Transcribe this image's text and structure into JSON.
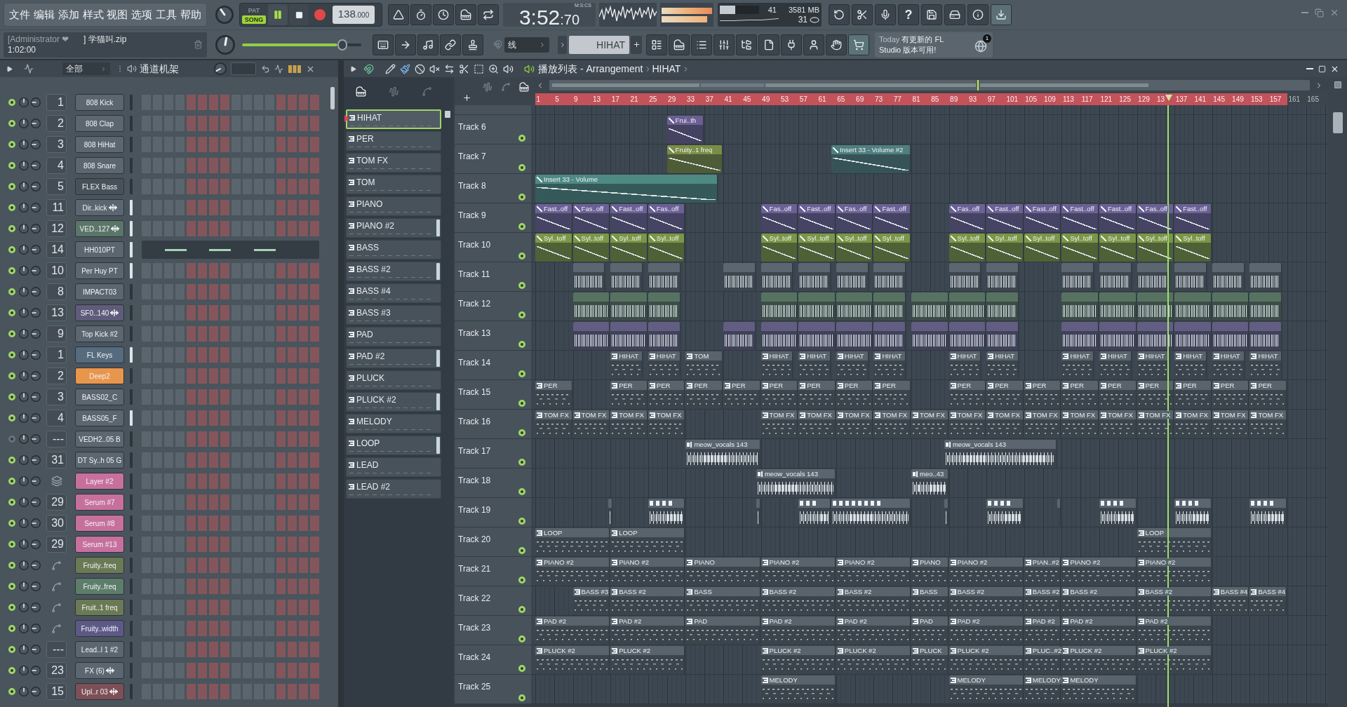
{
  "menu": [
    "文件",
    "编辑",
    "添加",
    "样式",
    "视图",
    "选项",
    "工具",
    "帮助"
  ],
  "transport": {
    "modes": [
      {
        "label": "PAT",
        "selected": false
      },
      {
        "label": "SONG",
        "selected": true
      }
    ],
    "playing": true,
    "tempo": "138",
    "tempo_fraction": ".000"
  },
  "clock": {
    "time": "3:52",
    "fraction": ":70",
    "unit": "M:S:CS"
  },
  "cpu": {
    "value": "41",
    "level": 0.4
  },
  "memory": "3581 MB",
  "polyphony": "31",
  "help_label": "?",
  "project": {
    "user": "[Administrator ❤",
    "file": "] 学猫叫.zip",
    "time": "1:02:00"
  },
  "master_volume": {
    "level": 0.84
  },
  "snap": "线",
  "pattern_selector": "HIHAT",
  "news": {
    "day": "Today",
    "message": "有更新的 FL Studio 版本可用!",
    "badge": "1"
  },
  "channel_rack": {
    "filter": "全部",
    "title": "通道机架",
    "channels": [
      {
        "name": "808 Kick",
        "mixer": "1",
        "kind": "instrument",
        "color": "#5b6670",
        "enabled": true,
        "selected": false
      },
      {
        "name": "808 Clap",
        "mixer": "2",
        "kind": "instrument",
        "color": "#5b6670",
        "enabled": true,
        "selected": false
      },
      {
        "name": "808 HiHat",
        "mixer": "3",
        "kind": "instrument",
        "color": "#5b6670",
        "enabled": true,
        "selected": false
      },
      {
        "name": "808 Snare",
        "mixer": "4",
        "kind": "instrument",
        "color": "#5b6670",
        "enabled": true,
        "selected": false
      },
      {
        "name": "FLEX Bass",
        "mixer": "5",
        "kind": "instrument",
        "color": "#47515a",
        "enabled": true,
        "selected": false
      },
      {
        "name": "Dir..kick",
        "mixer": "11",
        "kind": "sample",
        "color": "#5b6670",
        "enabled": true,
        "selected": true
      },
      {
        "name": "VED..127",
        "mixer": "12",
        "kind": "sample",
        "color": "#5b7668",
        "enabled": true,
        "selected": true
      },
      {
        "name": "HH010PT",
        "mixer": "14",
        "kind": "instrument",
        "color": "#5b6670",
        "enabled": true,
        "selected": true,
        "pianoroll": true
      },
      {
        "name": "Per Huy PT",
        "mixer": "10",
        "kind": "instrument",
        "color": "#5b6670",
        "enabled": true,
        "selected": true
      },
      {
        "name": "IMPACT03",
        "mixer": "8",
        "kind": "instrument",
        "color": "#5b6670",
        "enabled": true,
        "selected": false
      },
      {
        "name": "SF0..140",
        "mixer": "13",
        "kind": "sample",
        "color": "#5f5b7b",
        "enabled": true,
        "selected": false
      },
      {
        "name": "Top Kick #2",
        "mixer": "9",
        "kind": "instrument",
        "color": "#5b6670",
        "enabled": true,
        "selected": false
      },
      {
        "name": "FL Keys",
        "mixer": "1",
        "kind": "instrument",
        "color": "#566b7e",
        "enabled": true,
        "selected": true
      },
      {
        "name": "Deep2",
        "mixer": "2",
        "kind": "instrument",
        "color": "#e8964c",
        "enabled": true,
        "selected": false
      },
      {
        "name": "BASS02_C",
        "mixer": "3",
        "kind": "instrument",
        "color": "#5b6670",
        "enabled": true,
        "selected": false
      },
      {
        "name": "BASS05_F",
        "mixer": "4",
        "kind": "instrument",
        "color": "#5b6670",
        "enabled": true,
        "selected": true
      },
      {
        "name": "VEDH2..05 B",
        "mixer": "---",
        "kind": "instrument",
        "color": "#5b6670",
        "enabled": false,
        "selected": false
      },
      {
        "name": "DT Sy..h 05 G",
        "mixer": "31",
        "kind": "instrument",
        "color": "#5b6670",
        "enabled": true,
        "selected": false
      },
      {
        "name": "Layer #2",
        "kind": "layer",
        "color": "#c7709e",
        "enabled": true,
        "selected": false
      },
      {
        "name": "Serum #7",
        "mixer": "29",
        "kind": "instrument",
        "color": "#c7709e",
        "enabled": true,
        "selected": false
      },
      {
        "name": "Serum #8",
        "mixer": "30",
        "kind": "instrument",
        "color": "#c7709e",
        "enabled": true,
        "selected": false
      },
      {
        "name": "Serum #13",
        "mixer": "29",
        "kind": "instrument",
        "color": "#c7709e",
        "enabled": true,
        "selected": false
      },
      {
        "name": "Fruity..freq",
        "kind": "automation",
        "color": "#6a7a54",
        "enabled": true,
        "selected": false
      },
      {
        "name": "Fruity..freq",
        "kind": "automation",
        "color": "#5d7d6b",
        "enabled": true,
        "selected": false
      },
      {
        "name": "Fruit..1 freq",
        "kind": "automation",
        "color": "#6a7a54",
        "enabled": true,
        "selected": false
      },
      {
        "name": "Fruity..width",
        "kind": "automation",
        "color": "#5d5987",
        "enabled": true,
        "selected": false
      },
      {
        "name": "Lead..l 1 #2",
        "mixer": "---",
        "kind": "instrument",
        "color": "#5b6670",
        "enabled": true,
        "selected": false
      },
      {
        "name": "FX (6)",
        "mixer": "23",
        "kind": "sample",
        "color": "#5b6670",
        "enabled": true,
        "selected": false
      },
      {
        "name": "Upl..r 03",
        "mixer": "15",
        "kind": "sample",
        "color": "#7d4f57",
        "enabled": true,
        "selected": false
      }
    ]
  },
  "playlist": {
    "title": "播放列表 - Arrangement",
    "crumb": "HIHAT",
    "patterns": [
      {
        "name": "HIHAT",
        "selected": true,
        "marked": false
      },
      {
        "name": "PER",
        "selected": false,
        "marked": false
      },
      {
        "name": "TOM FX",
        "selected": false,
        "marked": false
      },
      {
        "name": "TOM",
        "selected": false,
        "marked": false
      },
      {
        "name": "PIANO",
        "selected": false,
        "marked": false
      },
      {
        "name": "PIANO #2",
        "selected": false,
        "marked": true
      },
      {
        "name": "BASS",
        "selected": false,
        "marked": false
      },
      {
        "name": "BASS #2",
        "selected": false,
        "marked": true
      },
      {
        "name": "BASS #4",
        "selected": false,
        "marked": false
      },
      {
        "name": "BASS #3",
        "selected": false,
        "marked": false
      },
      {
        "name": "PAD",
        "selected": false,
        "marked": false
      },
      {
        "name": "PAD #2",
        "selected": false,
        "marked": true
      },
      {
        "name": "PLUCK",
        "selected": false,
        "marked": false
      },
      {
        "name": "PLUCK #2",
        "selected": false,
        "marked": true
      },
      {
        "name": "MELODY",
        "selected": false,
        "marked": false
      },
      {
        "name": "LOOP",
        "selected": false,
        "marked": true
      },
      {
        "name": "LEAD",
        "selected": false,
        "marked": false
      },
      {
        "name": "LEAD #2",
        "selected": false,
        "marked": false
      }
    ],
    "ruler": [
      "1",
      "5",
      "9",
      "13",
      "17",
      "21",
      "25",
      "29",
      "33",
      "37",
      "41",
      "45",
      "49",
      "53",
      "57",
      "61",
      "65",
      "69",
      "73",
      "77",
      "81",
      "85",
      "89",
      "93",
      "97",
      "101",
      "105",
      "109",
      "113",
      "117",
      "121",
      "125",
      "129",
      "13",
      "137",
      "141",
      "145",
      "149",
      "153",
      "157",
      "161",
      "165"
    ],
    "tracks": [
      {
        "name": "Track 6",
        "enabled": true,
        "clips": [
          {
            "kind": "automation",
            "name": "Frui..th",
            "color": "#6b5f93"
          }
        ]
      },
      {
        "name": "Track 7",
        "enabled": true,
        "clips": [
          {
            "kind": "automation",
            "name": "Fruity..1 freq",
            "color": "#7a8d46"
          },
          {
            "kind": "automation",
            "name": "Insert 33 - Volume #2",
            "color": "#4f7f80"
          }
        ]
      },
      {
        "name": "Track 8",
        "enabled": true,
        "clips": [
          {
            "kind": "automation",
            "name": "Insert 33 - Volume",
            "color": "#4e8984"
          }
        ]
      },
      {
        "name": "Track 9",
        "enabled": true,
        "clips": [
          {
            "kind": "automation",
            "name": "Fast..off",
            "color": "#6b6196"
          },
          {
            "kind": "automation",
            "name": "Fas..off",
            "color": "#6b6196"
          },
          {
            "kind": "automation",
            "name": "Fast..off",
            "color": "#6b6196"
          },
          {
            "kind": "automation",
            "name": "Fas..off",
            "color": "#6b6196"
          },
          {
            "kind": "automation",
            "name": "Fas..off",
            "color": "#6b6196"
          },
          {
            "kind": "automation",
            "name": "Fast..off",
            "color": "#6b6196"
          },
          {
            "kind": "automation",
            "name": "Fas..off",
            "color": "#6b6196"
          },
          {
            "kind": "automation",
            "name": "Fast..off",
            "color": "#6b6196"
          },
          {
            "kind": "automation",
            "name": "Fas..off",
            "color": "#6b6196"
          },
          {
            "kind": "automation",
            "name": "Fast..off",
            "color": "#6b6196"
          },
          {
            "kind": "automation",
            "name": "Fast..off",
            "color": "#6b6196"
          },
          {
            "kind": "automation",
            "name": "Fast..off",
            "color": "#6b6196"
          },
          {
            "kind": "automation",
            "name": "Fast..off",
            "color": "#6b6196"
          },
          {
            "kind": "automation",
            "name": "Fas..off",
            "color": "#6b6196"
          },
          {
            "kind": "automation",
            "name": "Fast..off",
            "color": "#6b6196"
          }
        ]
      },
      {
        "name": "Track 10",
        "enabled": true,
        "clips": [
          {
            "kind": "automation",
            "name": "Syl..toff",
            "color": "#7b9646"
          },
          {
            "kind": "automation",
            "name": "Syl..toff",
            "color": "#7b9646"
          },
          {
            "kind": "automation",
            "name": "Syl..toff",
            "color": "#7b9646"
          },
          {
            "kind": "automation",
            "name": "Syl..toff",
            "color": "#7b9646"
          },
          {
            "kind": "automation",
            "name": "Syl..toff",
            "color": "#7b9646"
          },
          {
            "kind": "automation",
            "name": "Syl..toff",
            "color": "#7b9646"
          },
          {
            "kind": "automation",
            "name": "Syl..toff",
            "color": "#7b9646"
          },
          {
            "kind": "automation",
            "name": "Syl..toff",
            "color": "#7b9646"
          },
          {
            "kind": "automation",
            "name": "Syl..toff",
            "color": "#7b9646"
          },
          {
            "kind": "automation",
            "name": "Syl..toff",
            "color": "#7b9646"
          },
          {
            "kind": "automation",
            "name": "Syl..toff",
            "color": "#7b9646"
          },
          {
            "kind": "automation",
            "name": "Syl..toff",
            "color": "#7b9646"
          },
          {
            "kind": "automation",
            "name": "Syl..toff",
            "color": "#7b9646"
          },
          {
            "kind": "automation",
            "name": "Syl..toff",
            "color": "#7b9646"
          },
          {
            "kind": "automation",
            "name": "Syl..toff",
            "color": "#7b9646"
          }
        ]
      },
      {
        "name": "Track 11",
        "enabled": true,
        "clips": [
          {
            "kind": "drums",
            "color": "#5b6670"
          },
          {
            "kind": "drums",
            "color": "#5b6670"
          },
          {
            "kind": "drums",
            "color": "#5b6670"
          },
          {
            "kind": "drums",
            "color": "#5b6670"
          },
          {
            "kind": "drums",
            "color": "#5b6670"
          },
          {
            "kind": "drums",
            "color": "#5b6670"
          },
          {
            "kind": "drums",
            "color": "#5b6670"
          },
          {
            "kind": "drums",
            "color": "#5b6670"
          },
          {
            "kind": "drums",
            "color": "#5b6670"
          },
          {
            "kind": "drums",
            "color": "#5b6670"
          },
          {
            "kind": "drums",
            "color": "#5b6670"
          },
          {
            "kind": "drums",
            "color": "#5b6670"
          },
          {
            "kind": "drums",
            "color": "#5b6670"
          },
          {
            "kind": "drums",
            "color": "#5b6670"
          },
          {
            "kind": "drums",
            "color": "#5b6670"
          },
          {
            "kind": "drums",
            "color": "#5b6670"
          }
        ]
      },
      {
        "name": "Track 12",
        "enabled": true,
        "clips": [
          {
            "kind": "drums",
            "color": "#587262"
          },
          {
            "kind": "drums",
            "color": "#587262"
          },
          {
            "kind": "drums",
            "color": "#587262"
          },
          {
            "kind": "drums",
            "color": "#587262"
          },
          {
            "kind": "drums",
            "color": "#587262"
          },
          {
            "kind": "drums",
            "color": "#587262"
          },
          {
            "kind": "drums",
            "color": "#587262"
          },
          {
            "kind": "drums",
            "color": "#587262"
          },
          {
            "kind": "drums",
            "color": "#587262"
          },
          {
            "kind": "drums",
            "color": "#587262"
          },
          {
            "kind": "drums",
            "color": "#587262"
          },
          {
            "kind": "drums",
            "color": "#587262"
          },
          {
            "kind": "drums",
            "color": "#587262"
          },
          {
            "kind": "drums",
            "color": "#587262"
          },
          {
            "kind": "drums",
            "color": "#587262"
          },
          {
            "kind": "drums",
            "color": "#587262"
          }
        ]
      },
      {
        "name": "Track 13",
        "enabled": true,
        "clips": [
          {
            "kind": "drums",
            "color": "#625d82"
          },
          {
            "kind": "drums",
            "color": "#625d82"
          },
          {
            "kind": "drums",
            "color": "#625d82"
          },
          {
            "kind": "drums",
            "color": "#625d82"
          },
          {
            "kind": "drums",
            "color": "#625d82"
          },
          {
            "kind": "drums",
            "color": "#625d82"
          },
          {
            "kind": "drums",
            "color": "#625d82"
          },
          {
            "kind": "drums",
            "color": "#625d82"
          },
          {
            "kind": "drums",
            "color": "#625d82"
          },
          {
            "kind": "drums",
            "color": "#625d82"
          },
          {
            "kind": "drums",
            "color": "#625d82"
          },
          {
            "kind": "drums",
            "color": "#625d82"
          },
          {
            "kind": "drums",
            "color": "#625d82"
          },
          {
            "kind": "drums",
            "color": "#625d82"
          },
          {
            "kind": "drums",
            "color": "#625d82"
          },
          {
            "kind": "drums",
            "color": "#625d82"
          },
          {
            "kind": "drums",
            "color": "#625d82"
          }
        ]
      },
      {
        "name": "Track 14",
        "enabled": true,
        "clips": [
          {
            "kind": "pattern",
            "name": "HIHAT"
          },
          {
            "kind": "pattern",
            "name": "HIHAT"
          },
          {
            "kind": "pattern",
            "name": "TOM"
          },
          {
            "kind": "pattern",
            "name": "HIHAT"
          },
          {
            "kind": "pattern",
            "name": "HIHAT"
          },
          {
            "kind": "pattern",
            "name": "HIHAT"
          },
          {
            "kind": "pattern",
            "name": "HIHAT"
          },
          {
            "kind": "pattern",
            "name": "HIHAT"
          },
          {
            "kind": "pattern",
            "name": "HIHAT"
          },
          {
            "kind": "pattern",
            "name": "HIHAT"
          },
          {
            "kind": "pattern",
            "name": "HIHAT"
          },
          {
            "kind": "pattern",
            "name": "HIHAT"
          },
          {
            "kind": "pattern",
            "name": "HIHAT"
          },
          {
            "kind": "pattern",
            "name": "HIHAT"
          },
          {
            "kind": "pattern",
            "name": "HIHAT"
          }
        ]
      },
      {
        "name": "Track 15",
        "enabled": true,
        "clips": [
          {
            "kind": "pattern",
            "name": "PER"
          },
          {
            "kind": "pattern",
            "name": "PER"
          },
          {
            "kind": "pattern",
            "name": "PER"
          },
          {
            "kind": "pattern",
            "name": "PER"
          },
          {
            "kind": "pattern",
            "name": "PER"
          },
          {
            "kind": "pattern",
            "name": "PER"
          },
          {
            "kind": "pattern",
            "name": "PER"
          },
          {
            "kind": "pattern",
            "name": "PER"
          },
          {
            "kind": "pattern",
            "name": "PER"
          },
          {
            "kind": "pattern",
            "name": "PER"
          },
          {
            "kind": "pattern",
            "name": "PER"
          },
          {
            "kind": "pattern",
            "name": "PER"
          },
          {
            "kind": "pattern",
            "name": "PER"
          },
          {
            "kind": "pattern",
            "name": "PER"
          },
          {
            "kind": "pattern",
            "name": "PER"
          },
          {
            "kind": "pattern",
            "name": "PER"
          },
          {
            "kind": "pattern",
            "name": "PER"
          },
          {
            "kind": "pattern",
            "name": "PER"
          }
        ]
      },
      {
        "name": "Track 16",
        "enabled": true,
        "clips": [
          {
            "kind": "pattern",
            "name": "TOM FX"
          },
          {
            "kind": "pattern",
            "name": "TOM FX"
          },
          {
            "kind": "pattern",
            "name": "TOM FX"
          },
          {
            "kind": "pattern",
            "name": "TOM FX"
          },
          {
            "kind": "pattern",
            "name": "TOM FX"
          },
          {
            "kind": "pattern",
            "name": "TOM FX"
          },
          {
            "kind": "pattern",
            "name": "TOM FX"
          },
          {
            "kind": "pattern",
            "name": "TOM FX"
          },
          {
            "kind": "pattern",
            "name": "TOM FX"
          },
          {
            "kind": "pattern",
            "name": "TOM FX"
          },
          {
            "kind": "pattern",
            "name": "TOM FX"
          },
          {
            "kind": "pattern",
            "name": "TOM FX"
          },
          {
            "kind": "pattern",
            "name": "TOM FX"
          },
          {
            "kind": "pattern",
            "name": "TOM FX"
          },
          {
            "kind": "pattern",
            "name": "TOM FX"
          },
          {
            "kind": "pattern",
            "name": "TOM FX"
          },
          {
            "kind": "pattern",
            "name": "TOM FX"
          },
          {
            "kind": "pattern",
            "name": "TOM FX"
          }
        ]
      },
      {
        "name": "Track 17",
        "enabled": true,
        "clips": [
          {
            "kind": "audio",
            "name": "meow_vocals 143"
          },
          {
            "kind": "audio",
            "name": "meow_vocals 143"
          }
        ]
      },
      {
        "name": "Track 18",
        "enabled": true,
        "clips": [
          {
            "kind": "audio",
            "name": "meow_vocals 143"
          },
          {
            "kind": "audio",
            "name": "meo..43"
          }
        ]
      },
      {
        "name": "Track 19",
        "enabled": true,
        "clips": [
          {
            "kind": "slices"
          },
          {
            "kind": "slices"
          },
          {
            "kind": "slices"
          },
          {
            "kind": "slices"
          },
          {
            "kind": "slices"
          },
          {
            "kind": "slices"
          },
          {
            "kind": "slices"
          },
          {
            "kind": "slices"
          },
          {
            "kind": "slices"
          },
          {
            "kind": "slices"
          },
          {
            "kind": "slices"
          }
        ]
      },
      {
        "name": "Track 20",
        "enabled": true,
        "clips": [
          {
            "kind": "pattern",
            "name": "LOOP"
          },
          {
            "kind": "pattern",
            "name": "LOOP"
          },
          {
            "kind": "pattern",
            "name": "LOOP"
          }
        ]
      },
      {
        "name": "Track 21",
        "enabled": true,
        "clips": [
          {
            "kind": "pattern",
            "name": "PIANO #2"
          },
          {
            "kind": "pattern",
            "name": "PIANO #2"
          },
          {
            "kind": "pattern",
            "name": "PIANO"
          },
          {
            "kind": "pattern",
            "name": "PIANO #2"
          },
          {
            "kind": "pattern",
            "name": "PIANO #2"
          },
          {
            "kind": "pattern",
            "name": "PIANO"
          },
          {
            "kind": "pattern",
            "name": "PIANO #2"
          },
          {
            "kind": "pattern",
            "name": "PIAN..#2"
          },
          {
            "kind": "pattern",
            "name": "PIANO #2"
          },
          {
            "kind": "pattern",
            "name": "PIANO #2"
          }
        ]
      },
      {
        "name": "Track 22",
        "enabled": true,
        "clips": [
          {
            "kind": "pattern",
            "name": "BASS #3"
          },
          {
            "kind": "pattern",
            "name": "BASS #2"
          },
          {
            "kind": "pattern",
            "name": "BASS"
          },
          {
            "kind": "pattern",
            "name": "BASS #2"
          },
          {
            "kind": "pattern",
            "name": "BASS #2"
          },
          {
            "kind": "pattern",
            "name": "BASS"
          },
          {
            "kind": "pattern",
            "name": "BASS #2"
          },
          {
            "kind": "pattern",
            "name": "BASS #2"
          },
          {
            "kind": "pattern",
            "name": "BASS #2"
          },
          {
            "kind": "pattern",
            "name": "BASS #2"
          },
          {
            "kind": "pattern",
            "name": "BASS #4"
          },
          {
            "kind": "pattern",
            "name": "BASS #4"
          }
        ]
      },
      {
        "name": "Track 23",
        "enabled": true,
        "clips": [
          {
            "kind": "pattern",
            "name": "PAD #2"
          },
          {
            "kind": "pattern",
            "name": "PAD #2"
          },
          {
            "kind": "pattern",
            "name": "PAD"
          },
          {
            "kind": "pattern",
            "name": "PAD #2"
          },
          {
            "kind": "pattern",
            "name": "PAD #2"
          },
          {
            "kind": "pattern",
            "name": "PAD"
          },
          {
            "kind": "pattern",
            "name": "PAD #2"
          },
          {
            "kind": "pattern",
            "name": "PAD #2"
          },
          {
            "kind": "pattern",
            "name": "PAD #2"
          },
          {
            "kind": "pattern",
            "name": "PAD #2"
          }
        ]
      },
      {
        "name": "Track 24",
        "enabled": true,
        "clips": [
          {
            "kind": "pattern",
            "name": "PLUCK #2"
          },
          {
            "kind": "pattern",
            "name": "PLUCK #2"
          },
          {
            "kind": "pattern",
            "name": "PLUCK #2"
          },
          {
            "kind": "pattern",
            "name": "PLUCK #2"
          },
          {
            "kind": "pattern",
            "name": "PLUCK"
          },
          {
            "kind": "pattern",
            "name": "PLUCK #2"
          },
          {
            "kind": "pattern",
            "name": "PLUC..#2"
          },
          {
            "kind": "pattern",
            "name": "PLUCK #2"
          },
          {
            "kind": "pattern",
            "name": "PLUCK #2"
          }
        ]
      },
      {
        "name": "Track 25",
        "enabled": true,
        "clips": [
          {
            "kind": "pattern",
            "name": "MELODY"
          },
          {
            "kind": "pattern",
            "name": "MELODY"
          },
          {
            "kind": "pattern",
            "name": "MELODY"
          },
          {
            "kind": "pattern",
            "name": "MELODY"
          }
        ]
      }
    ]
  }
}
